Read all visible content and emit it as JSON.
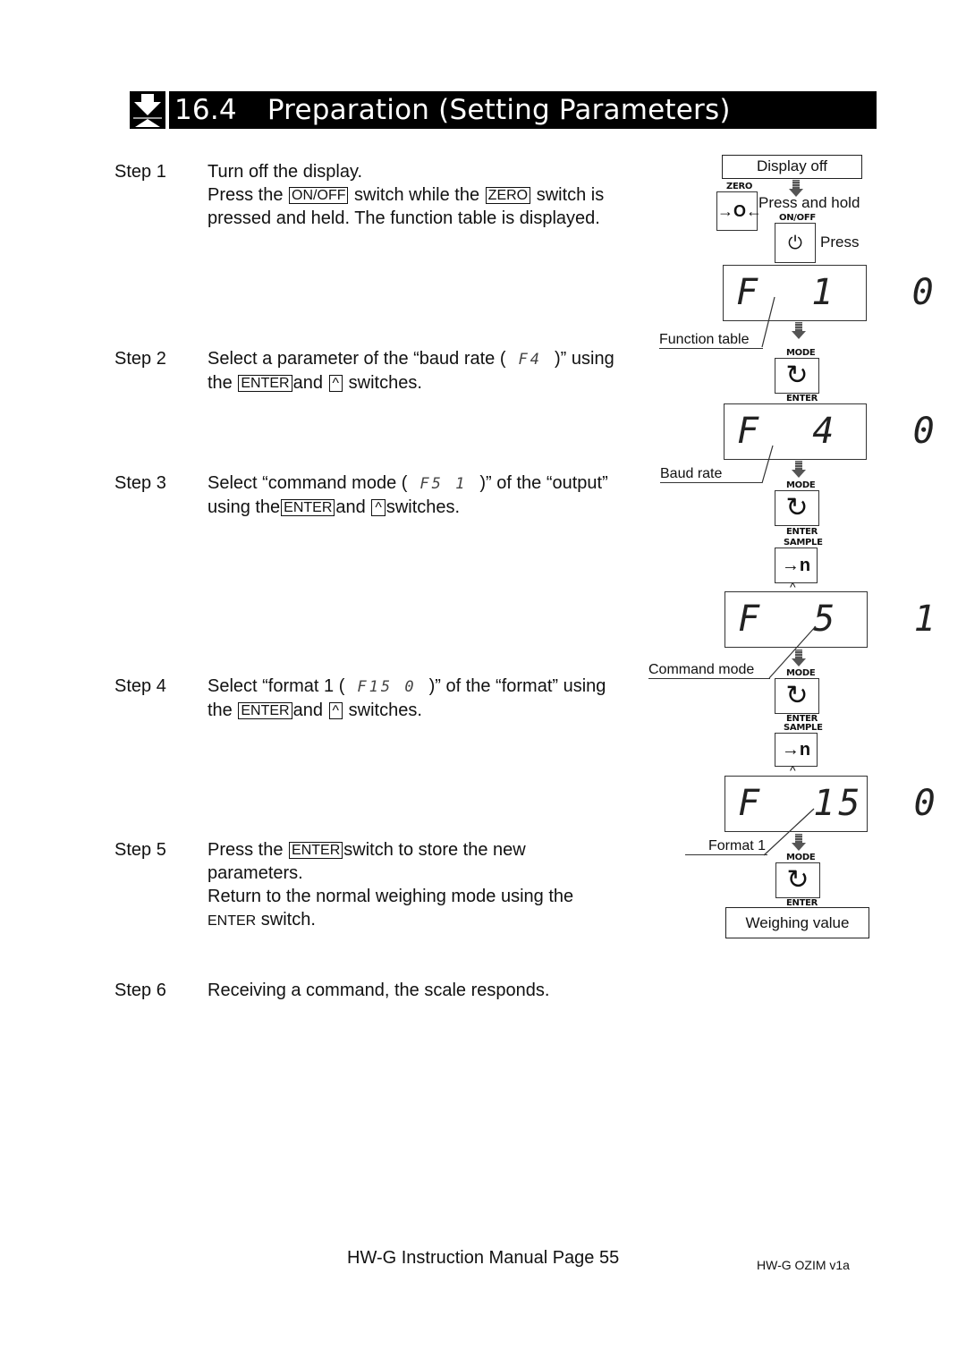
{
  "header": {
    "section_number": "16.4",
    "title": "Preparation (Setting Parameters)",
    "icon": "down-arrow-to-line-icon"
  },
  "steps": [
    {
      "label": "Step 1",
      "lines": [
        {
          "text": "Turn off the display."
        },
        {
          "pre": "Press the",
          "key1": "ON/OFF",
          "mid": "switch while the",
          "key2": "ZERO",
          "post": "switch is"
        },
        {
          "text": "pressed and held. The function table is displayed."
        }
      ]
    },
    {
      "label": "Step 2",
      "line1_pre": "Select a parameter of the “baud rate (",
      "line1_code": "F4",
      "line1_post": ")” using",
      "line2_pre": "the",
      "key1": "ENTER",
      "mid": "and",
      "key2": "^",
      "post": "switches."
    },
    {
      "label": "Step 3",
      "line1_pre": "Select “command mode (",
      "line1_code": "F5  1",
      "line1_post": ")” of the “output”",
      "line2_pre": "using the",
      "key1": "ENTER",
      "mid": "and",
      "key2": "^",
      "post": "switches."
    },
    {
      "label": "Step 4",
      "line1_pre": "Select “format 1 (",
      "line1_code": "F15 0",
      "line1_post": ")” of the “format” using",
      "line2_pre": "the",
      "key1": "ENTER",
      "mid": "and",
      "key2": "^",
      "post": "switches."
    },
    {
      "label": "Step 5",
      "line1_pre": "Press the",
      "key1": "ENTER",
      "line1_post": "switch to store the new",
      "line2": "parameters.",
      "line3": "Return to the normal weighing mode using the",
      "line4_key": "ENTER",
      "line4_post": "switch."
    },
    {
      "label": "Step 6",
      "text": "Receiving a command, the scale responds."
    }
  ],
  "diagram": {
    "display_off": "Display off",
    "zero_label": "ZERO",
    "zero_key_glyph": "→O←",
    "press_and_hold": "Press and hold",
    "onoff_label": "ON/OFF",
    "power_glyph": "⏻",
    "press": "Press",
    "lcd_function_table": "F  1   0",
    "function_table_label": "Function table",
    "mode_label": "MODE",
    "enter_label": "ENTER",
    "sample_label": "SAMPLE",
    "cycle_glyph": "↻",
    "sample_glyph": "→n",
    "caret": "^",
    "lcd_baud_rate": "F  4   0",
    "baud_rate_label": "Baud rate",
    "lcd_command_mode": "F  5   1",
    "command_mode_label": "Command mode",
    "lcd_format": "F  15  0",
    "format_label": "Format 1",
    "weighing_value": "Weighing value"
  },
  "footer": {
    "page_label": "HW-G Instruction Manual Page 55",
    "doc_code": "HW-G OZIM v1a"
  }
}
